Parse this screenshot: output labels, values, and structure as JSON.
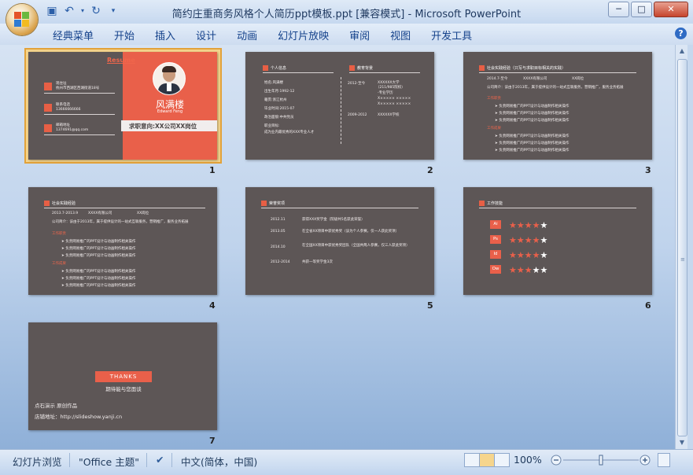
{
  "app": {
    "title": "简约庄重商务风格个人简历ppt模板.ppt [兼容模式] - Microsoft PowerPoint",
    "tabs": [
      "经典菜单",
      "开始",
      "插入",
      "设计",
      "动画",
      "幻灯片放映",
      "审阅",
      "视图",
      "开发工具"
    ],
    "help_icon": "?"
  },
  "status": {
    "view_name": "幻灯片浏览",
    "theme": "\"Office 主题\"",
    "language": "中文(简体，中国)",
    "zoom": "100%"
  },
  "slides": {
    "s1": {
      "num": "1",
      "resume_label": "Resume",
      "address_label": "现住址",
      "address": "杭州市西湖区西湖街道18号",
      "phone_label": "联系电话",
      "phone": "13666666666",
      "email_label": "邮箱地址",
      "email": "1374691@qq.com",
      "name": "风满楼",
      "name_en": "Edward Feng",
      "intent": "求职意向:XX公司XX岗位"
    },
    "s2": {
      "num": "2",
      "section1": "个人信息",
      "section2": "教育背景",
      "info": [
        "姓名:风满楼",
        "出生年月:1992-12",
        "籍贯:浙江杭州",
        "毕业时间:2015-07",
        "政治面貌:中共党员",
        "职业目标:",
        "成为业内最优秀的XXX专业人才"
      ],
      "edu_period1": "2012-至今",
      "edu_school1": "XXXXXX大学",
      "edu_school1_note": "（211/985院校）",
      "edu_major": "-专业学历",
      "edu_lines": [
        "X×××××  ×××××",
        "X×××××  ×××××"
      ],
      "edu_period2": "2009-2012",
      "edu_school2": "XXXXXX学校"
    },
    "s3": {
      "num": "3",
      "section": "社会实践经验（只写与求职目标相关的实践）",
      "period": "2014.7-至今",
      "company": "XXXX有限公司",
      "position": "XX岗位",
      "intro": "公司简介：该由于2013年，属于提供设计的一站式互联服务，营销推广，服务业务拓展",
      "cat1": "工作职责",
      "cat2": "工作成果",
      "bullets": [
        "负责网易推广的PPT设计与动画制作相关操作",
        "负责网易推广的PPT设计与动画制作相关操作",
        "负责网易推广的PPT设计与动画制作相关操作"
      ]
    },
    "s4": {
      "num": "4",
      "section": "社会实践经验",
      "period": "2013.7-2013.9",
      "company": "XXXX有限公司",
      "position": "XX岗位",
      "intro": "公司简介：该由于2013年，属于提供设计的一站式互联服务，营销推广，服务业务拓展",
      "cat1": "工作职责",
      "cat2": "工作成果",
      "bullets": [
        "负责网易推广的PPT设计与动画制作相关操作",
        "负责网易推广的PPT设计与动画制作相关操作",
        "负责网易推广的PPT设计与动画制作相关操作"
      ]
    },
    "s5": {
      "num": "5",
      "section": "荣誉奖项",
      "rows": [
        {
          "date": "2012.11",
          "text": "获得XXX奖学金（院级共5名获此荣誉）"
        },
        {
          "date": "2013.05",
          "text": "在全省XX项目中获优秀奖（该为个人参赛，仅一人获此奖项）"
        },
        {
          "date": "2014.10",
          "text": "在全国XX项目中获优秀奖团队（全国共两人参赛，仅三人获此奖项）"
        },
        {
          "date": "2012-2014",
          "text": "共获一等奖学金3次"
        }
      ]
    },
    "s6": {
      "num": "6",
      "section": "工作技能",
      "skills": [
        {
          "label": "Ai",
          "stars": "★★★★★",
          "level": 4
        },
        {
          "label": "Ps",
          "stars": "★★★★★",
          "level": 4
        },
        {
          "label": "Id",
          "stars": "★★★★★",
          "level": 4
        },
        {
          "label": "Ow",
          "stars": "★★★★★",
          "level": 3
        }
      ]
    },
    "s7": {
      "num": "7",
      "thanks": "THANKS",
      "sub": "期待能与您面谈",
      "note": "点石演示  原创作品",
      "url": "店铺地址：http://slideshow.yanji.cn"
    }
  },
  "colors": {
    "accent": "#e9604a",
    "slide_bg": "#5d5656",
    "selection": "#e2a23a",
    "ribbon_text": "#15428b"
  }
}
